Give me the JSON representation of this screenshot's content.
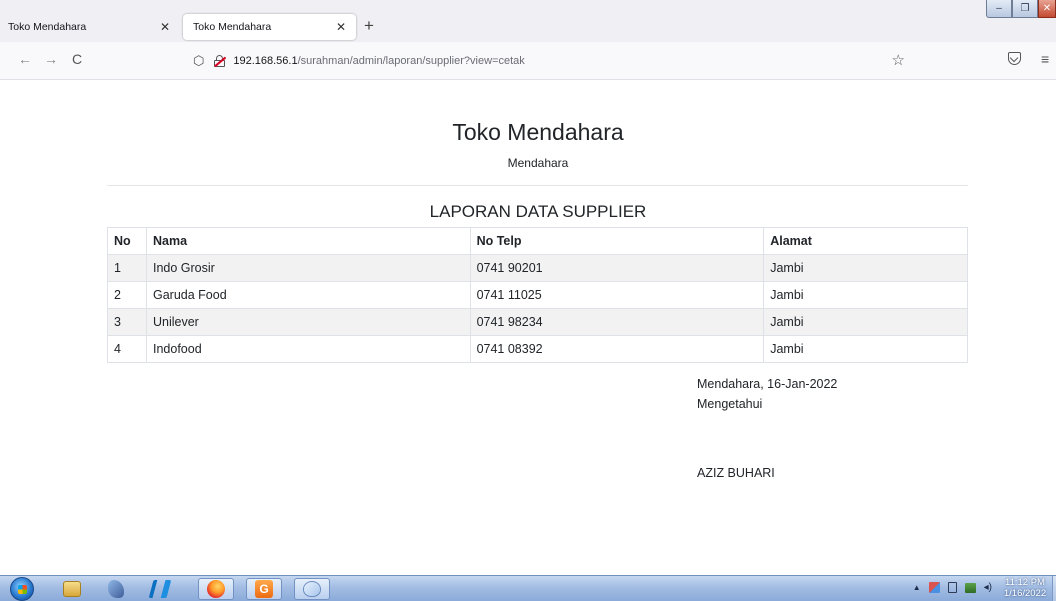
{
  "browser": {
    "tabs": [
      {
        "label": "Toko Mendahara",
        "active": false
      },
      {
        "label": "Toko Mendahara",
        "active": true
      }
    ],
    "new_tab_symbol": "+",
    "close_symbol": "✕",
    "url_host": "192.168.56.1",
    "url_path": "/surahman/admin/laporan/supplier?view=cetak",
    "nav": {
      "back": "←",
      "forward": "→",
      "reload": "C",
      "star": "☆",
      "menu": "≡"
    },
    "window_controls": {
      "minimize": "–",
      "restore": "❐",
      "close": "✕"
    }
  },
  "page": {
    "store_name": "Toko Mendahara",
    "store_city": "Mendahara",
    "report_title": "LAPORAN DATA SUPPLIER",
    "table": {
      "headers": [
        "No",
        "Nama",
        "No Telp",
        "Alamat"
      ],
      "rows": [
        [
          "1",
          "Indo Grosir",
          "0741 90201",
          "Jambi"
        ],
        [
          "2",
          "Garuda Food",
          "0741 11025",
          "Jambi"
        ],
        [
          "3",
          "Unilever",
          "0741 98234",
          "Jambi"
        ],
        [
          "4",
          "Indofood",
          "0741 08392",
          "Jambi"
        ]
      ]
    },
    "signature": {
      "place_date": "Mendahara, 16-Jan-2022",
      "acknowledged": "Mengetahui",
      "signer": "AZIZ BUHARI"
    }
  },
  "taskbar": {
    "apps": [
      "windows-explorer",
      "dolphin",
      "vscode",
      "firefox",
      "orange-app",
      "paint"
    ],
    "orange_app_letter": "G",
    "tray_arrow": "▲",
    "clock_time": "11:12 PM",
    "clock_date": "1/16/2022"
  },
  "colors": {
    "tabbar_bg": "#f0f0f4",
    "striped_row": "#f2f2f2",
    "taskbar_blue": "#a3bde3"
  }
}
